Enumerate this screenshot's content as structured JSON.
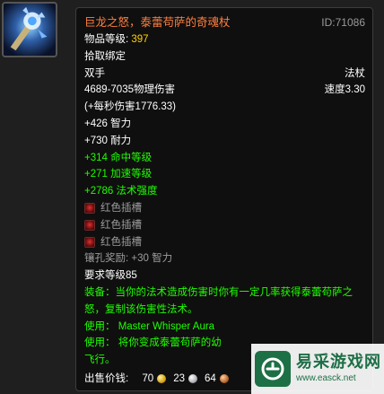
{
  "item": {
    "name": "巨龙之怒，泰蕾苟萨的奇魂杖",
    "id": "ID:71086",
    "level_label": "物品等级: ",
    "level_value": "397",
    "bind": "拾取绑定",
    "hand": "双手",
    "type": "法杖",
    "damage": "4689-7035物理伤害",
    "speed": "速度3.30",
    "dps": "(+每秒伤害1776.33)",
    "base_stats": [
      "+426 智力",
      "+730 耐力"
    ],
    "green_stats": [
      "+314 命中等级",
      "+271 加速等级",
      "+2786 法术强度"
    ],
    "sockets": [
      "红色插槽",
      "红色插槽",
      "红色插槽"
    ],
    "socket_bonus": "镶孔奖励: +30 智力",
    "required_level": "要求等级85",
    "equip": "装备：当你的法术造成伤害时你有一定几率获得泰蕾苟萨之怒，复制该伤害性法术。",
    "use1": "使用： Master Whisper Aura",
    "use2": "使用： 将你变成泰蕾苟萨的幼",
    "use2_cont": "飞行。",
    "sell_label": "出售价钱:",
    "sell_gold": "70",
    "sell_silver": "23",
    "sell_copper": "64"
  },
  "watermark": {
    "name": "易采游戏网",
    "url": "www.easck.net"
  },
  "colors": {
    "title": "#ff8040",
    "green": "#1eff00",
    "grey": "#9d9d9d",
    "id": "#9a9a9a"
  }
}
